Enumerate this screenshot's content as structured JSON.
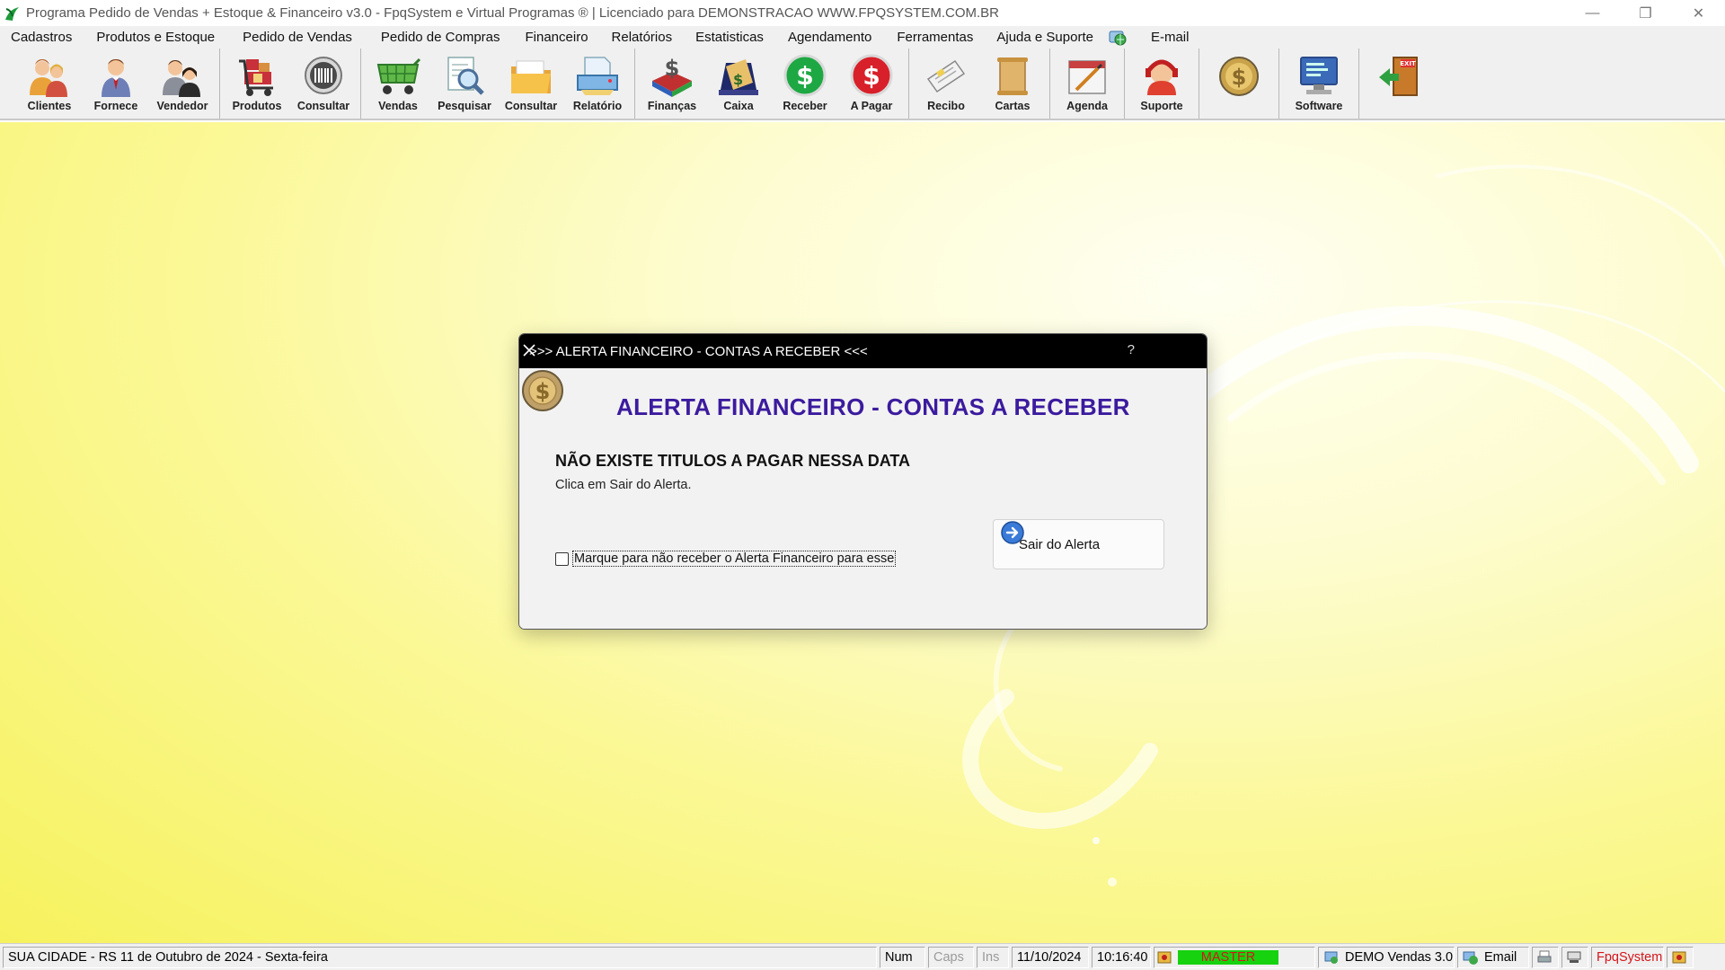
{
  "window": {
    "title": "Programa Pedido de Vendas + Estoque & Financeiro v3.0 - FpqSystem e Virtual Programas ® | Licenciado para  DEMONSTRACAO WWW.FPQSYSTEM.COM.BR",
    "minimize_glyph": "—",
    "restore_glyph": "❐",
    "close_glyph": "✕"
  },
  "menu": {
    "items": [
      "Cadastros",
      "Produtos e Estoque",
      "Pedido de Vendas",
      "Pedido de Compras",
      "Financeiro",
      "Relatórios",
      "Estatisticas",
      "Agendamento",
      "Ferramentas",
      "Ajuda e Suporte"
    ],
    "email": "E-mail"
  },
  "toolbar": {
    "clientes": "Clientes",
    "fornece": "Fornece",
    "vendedor": "Vendedor",
    "produtos": "Produtos",
    "consultar_estoque": "Consultar",
    "vendas": "Vendas",
    "pesquisar": "Pesquisar",
    "consultar_vendas": "Consultar",
    "relatorio": "Relatório",
    "financas": "Finanças",
    "caixa": "Caixa",
    "receber": "Receber",
    "apagar": "A Pagar",
    "recibo": "Recibo",
    "cartas": "Cartas",
    "agenda": "Agenda",
    "suporte": "Suporte",
    "software": "Software"
  },
  "dialog": {
    "title": ">>> ALERTA FINANCEIRO - CONTAS A RECEBER <<<",
    "help": "?",
    "heading": "ALERTA FINANCEIRO - CONTAS A RECEBER",
    "message": "NÃO EXISTE TITULOS A PAGAR NESSA DATA",
    "sub": "Clica em Sair do Alerta.",
    "checkbox_label": "Marque para não receber o Alerta Financeiro para esse",
    "checkbox_checked": false,
    "button_label": "Sair do Alerta"
  },
  "statusbar": {
    "location_date": "SUA CIDADE - RS 11 de Outubro de 2024 - Sexta-feira",
    "num": "Num",
    "caps": "Caps",
    "ins": "Ins",
    "date": "11/10/2024",
    "time": "10:16:40",
    "user": "MASTER",
    "version": "DEMO Vendas 3.0",
    "email": "Email",
    "brand": "FpqSystem"
  },
  "colors": {
    "dialog_heading": "#3b1b9e",
    "master_bg": "#16d20f",
    "master_text": "#d4151b",
    "receber_green": "#1ea843",
    "apagar_red": "#d8202a"
  }
}
